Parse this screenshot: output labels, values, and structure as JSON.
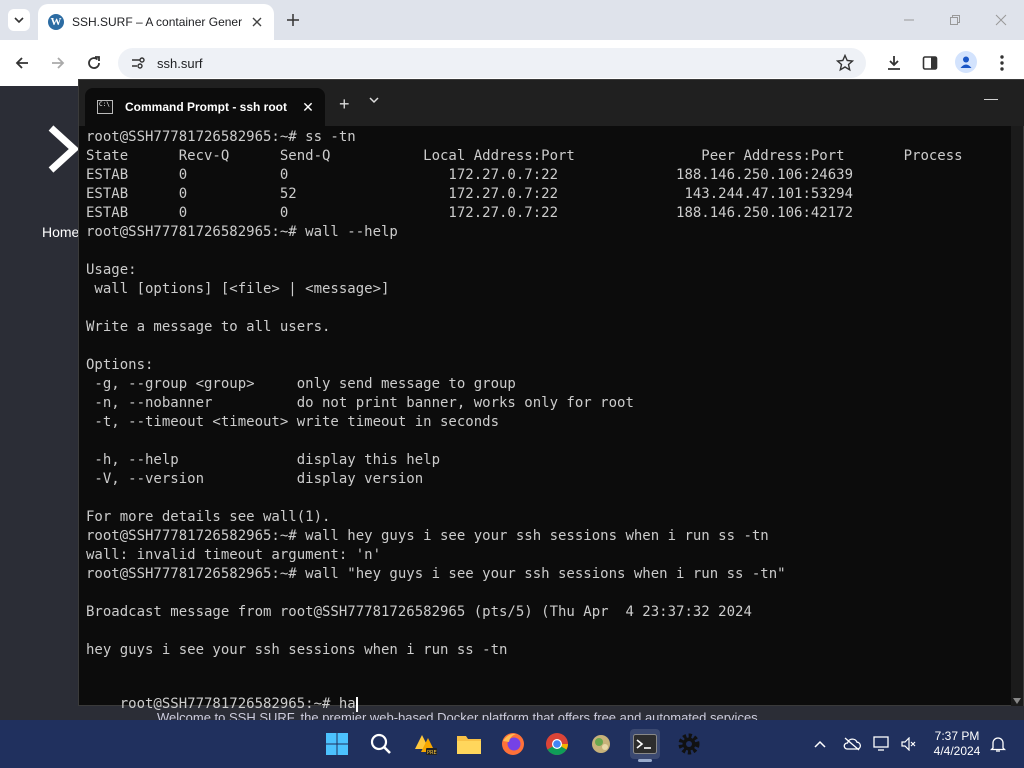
{
  "browser": {
    "tab_title": "SSH.SURF – A container Genera",
    "url": "ssh.surf"
  },
  "page": {
    "nav_home": "Home",
    "welcome_text": "Welcome to SSH.SURF, the premier web-based Docker platform that offers free and automated services."
  },
  "terminal": {
    "tab_title": "Command Prompt - ssh  root",
    "lines": [
      "root@SSH77781726582965:~# ss -tn",
      "State      Recv-Q      Send-Q           Local Address:Port               Peer Address:Port       Process",
      "ESTAB      0           0                   172.27.0.7:22              188.146.250.106:24639",
      "ESTAB      0           52                  172.27.0.7:22               143.244.47.101:53294",
      "ESTAB      0           0                   172.27.0.7:22              188.146.250.106:42172",
      "root@SSH77781726582965:~# wall --help",
      "",
      "Usage:",
      " wall [options] [<file> | <message>]",
      "",
      "Write a message to all users.",
      "",
      "Options:",
      " -g, --group <group>     only send message to group",
      " -n, --nobanner          do not print banner, works only for root",
      " -t, --timeout <timeout> write timeout in seconds",
      "",
      " -h, --help              display this help",
      " -V, --version           display version",
      "",
      "For more details see wall(1).",
      "root@SSH77781726582965:~# wall hey guys i see your ssh sessions when i run ss -tn",
      "wall: invalid timeout argument: 'n'",
      "root@SSH77781726582965:~# wall \"hey guys i see your ssh sessions when i run ss -tn\"",
      "",
      "Broadcast message from root@SSH77781726582965 (pts/5) (Thu Apr  4 23:37:32 2024",
      "",
      "hey guys i see your ssh sessions when i run ss -tn",
      ""
    ],
    "current_prompt": "root@SSH77781726582965:~# ",
    "current_input": "ha"
  },
  "taskbar": {
    "time": "7:37 PM",
    "date": "4/4/2024",
    "pinned": [
      "windows-start-icon",
      "search-icon",
      "sticky-notes-icon",
      "file-explorer-icon",
      "firefox-icon",
      "chrome-icon",
      "remote-app-icon",
      "terminal-icon",
      "settings-icon"
    ]
  },
  "colors": {
    "terminal_bg": "#0c0c0c",
    "terminal_fg": "#cccccc",
    "taskbar_bg": "#20305e",
    "page_bg": "#2b2d36"
  }
}
